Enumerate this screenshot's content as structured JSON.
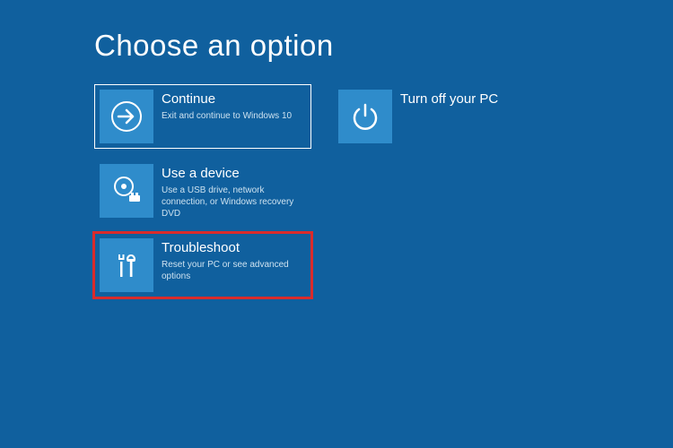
{
  "page_title": "Choose an option",
  "options": {
    "continue": {
      "title": "Continue",
      "desc": "Exit and continue to Windows 10"
    },
    "turnoff": {
      "title": "Turn off your PC",
      "desc": ""
    },
    "usedevice": {
      "title": "Use a device",
      "desc": "Use a USB drive, network connection, or Windows recovery DVD"
    },
    "troubleshoot": {
      "title": "Troubleshoot",
      "desc": "Reset your PC or see advanced options"
    }
  }
}
